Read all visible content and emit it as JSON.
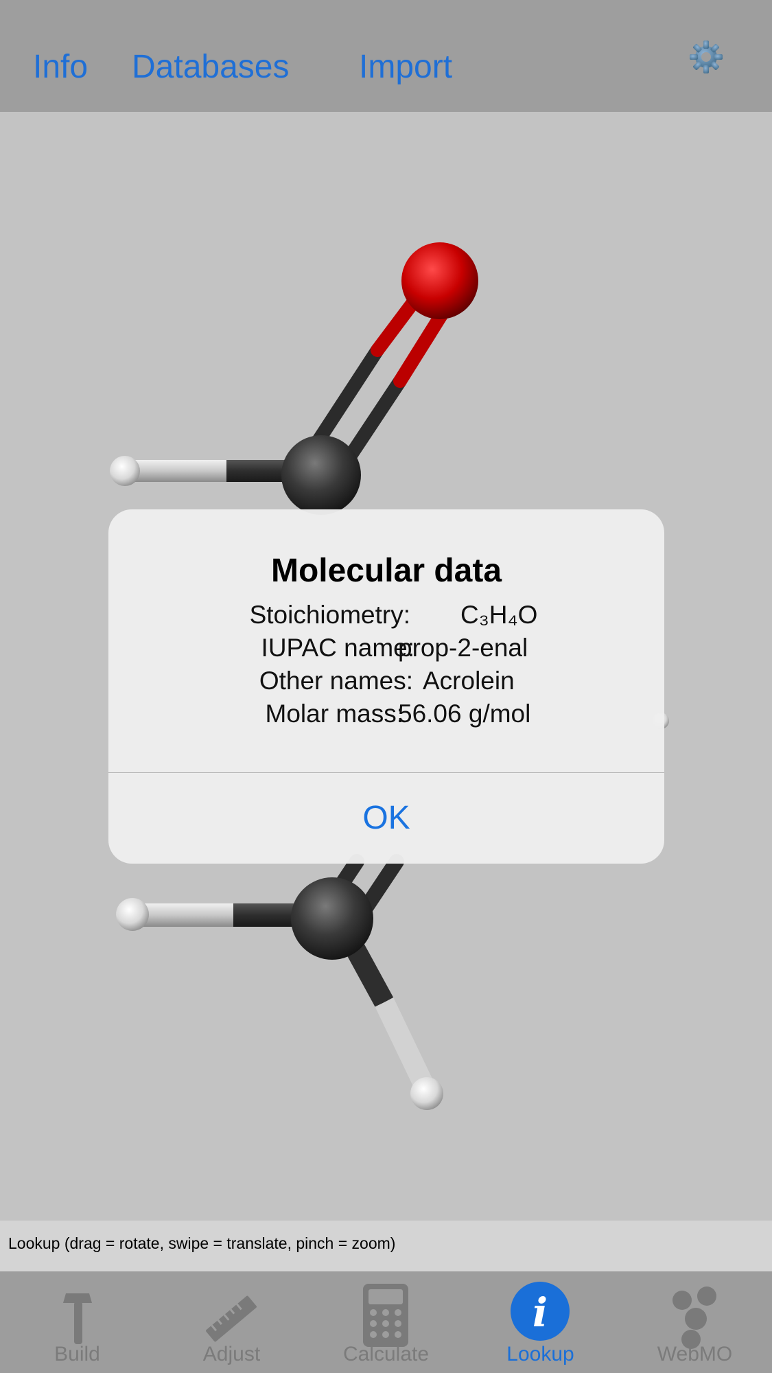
{
  "top_nav": {
    "info_label": "Info",
    "databases_label": "Databases",
    "import_label": "Import",
    "settings_icon": "gear-icon"
  },
  "status_bar": {
    "text": "Lookup (drag = rotate, swipe = translate, pinch = zoom)"
  },
  "dialog": {
    "title": "Molecular data",
    "rows": [
      {
        "label": "Stoichiometry:",
        "value": "C₃H₄O"
      },
      {
        "label": "IUPAC name:",
        "value": "prop-2-enal"
      },
      {
        "label": "Other names:",
        "value": "Acrolein"
      },
      {
        "label": "Molar mass:",
        "value": "56.06 g/mol"
      }
    ],
    "ok_label": "OK"
  },
  "tabs": [
    {
      "label": "Build",
      "icon": "hammer-icon",
      "active": false
    },
    {
      "label": "Adjust",
      "icon": "ruler-icon",
      "active": false
    },
    {
      "label": "Calculate",
      "icon": "calculator-icon",
      "active": false
    },
    {
      "label": "Lookup",
      "icon": "info-icon",
      "active": true
    },
    {
      "label": "WebMO",
      "icon": "molecule-icon",
      "active": false
    }
  ],
  "colors": {
    "accent": "#1a73e0",
    "oxygen": "#cc0000",
    "carbon": "#333333",
    "hydrogen": "#e6e6e6"
  }
}
